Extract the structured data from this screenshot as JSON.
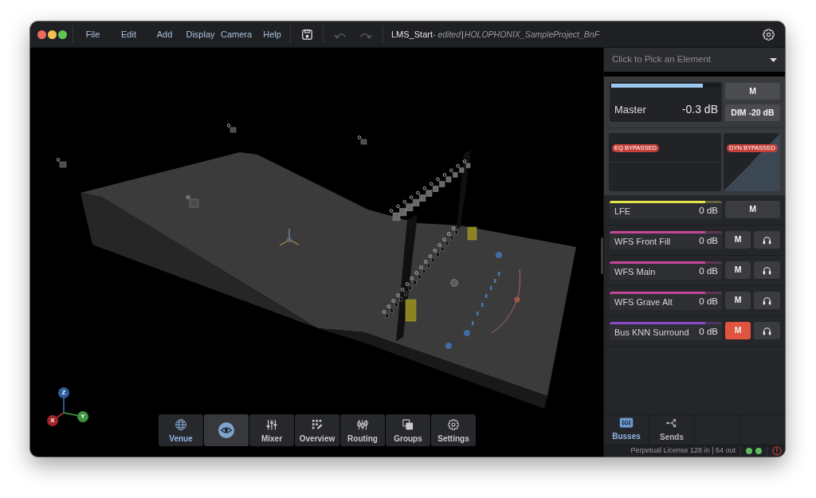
{
  "window": {
    "controls": [
      {
        "color": "#ec6a5e"
      },
      {
        "color": "#f4bf4f"
      },
      {
        "color": "#61c554"
      }
    ]
  },
  "menu": [
    "File",
    "Edit",
    "Add",
    "Display",
    "Camera",
    "Help"
  ],
  "toolbar": [
    {
      "kind": "save",
      "disabled": false
    },
    {
      "kind": "undo",
      "disabled": true
    },
    {
      "kind": "redo",
      "disabled": true
    }
  ],
  "title": {
    "document": "LMS_Start",
    "status": "- edited",
    "separator": "|",
    "project": "HOLOPHONIX_SampleProject_BnF"
  },
  "viewport": {
    "axes": [
      {
        "label": "Z",
        "color": "#2d5d9a"
      },
      {
        "label": "X",
        "color": "#a0262c"
      },
      {
        "label": "Y",
        "color": "#3e9440"
      }
    ]
  },
  "nav": [
    {
      "kind": "tab",
      "label": "Venue",
      "selected": true
    },
    {
      "kind": "toggle",
      "on": true
    },
    {
      "kind": "tab",
      "label": "Mixer",
      "selected": false
    },
    {
      "kind": "tab",
      "label": "Overview",
      "selected": false
    },
    {
      "kind": "tab",
      "label": "Routing",
      "selected": false
    },
    {
      "kind": "tab",
      "label": "Groups",
      "selected": false
    },
    {
      "kind": "tab",
      "label": "Settings",
      "selected": false
    }
  ],
  "inspector": {
    "picker": {
      "label": "Click to Pick an Element"
    },
    "master": {
      "name": "Master",
      "reading": "-0.3 dB",
      "level": 0.84,
      "buttons": [
        {
          "label": "M",
          "on": false
        },
        {
          "label": "DIM -20 dB",
          "on": false
        }
      ]
    },
    "processing": {
      "eq": {
        "badge": "EQ BYPASSED"
      },
      "dynamics": {
        "badge": "DYN BYPASSED"
      }
    },
    "busses": [
      {
        "kind": "lfe",
        "name": "LFE",
        "reading": "0 dB",
        "level": 0.85,
        "color": "#e6e64a",
        "mute": {
          "label": "M",
          "on": false
        }
      },
      {
        "kind": "bus",
        "name": "WFS Front Fill",
        "reading": "0 dB",
        "level": 0.85,
        "color": "#c4479a",
        "mute": {
          "label": "M",
          "on": false
        }
      },
      {
        "kind": "bus",
        "name": "WFS Main",
        "reading": "0 dB",
        "level": 0.85,
        "color": "#c4479a",
        "mute": {
          "label": "M",
          "on": false
        }
      },
      {
        "kind": "bus",
        "name": "WFS Grave Alt",
        "reading": "0 dB",
        "level": 0.85,
        "color": "#c4479a",
        "mute": {
          "label": "M",
          "on": false
        }
      },
      {
        "kind": "bus",
        "name": "Bus KNN Surround",
        "reading": "0 dB",
        "level": 0.85,
        "color": "#8d47c9",
        "mute": {
          "label": "M",
          "on": true
        }
      }
    ],
    "tabs": [
      {
        "label": "Busses",
        "selected": true
      },
      {
        "label": "Sends",
        "selected": false
      }
    ]
  },
  "status_bar": {
    "license": "Perpetual License 128 in | 64 out",
    "lights": [
      {
        "color": "#5cbd5c"
      },
      {
        "color": "#5cbd5c"
      }
    ]
  }
}
